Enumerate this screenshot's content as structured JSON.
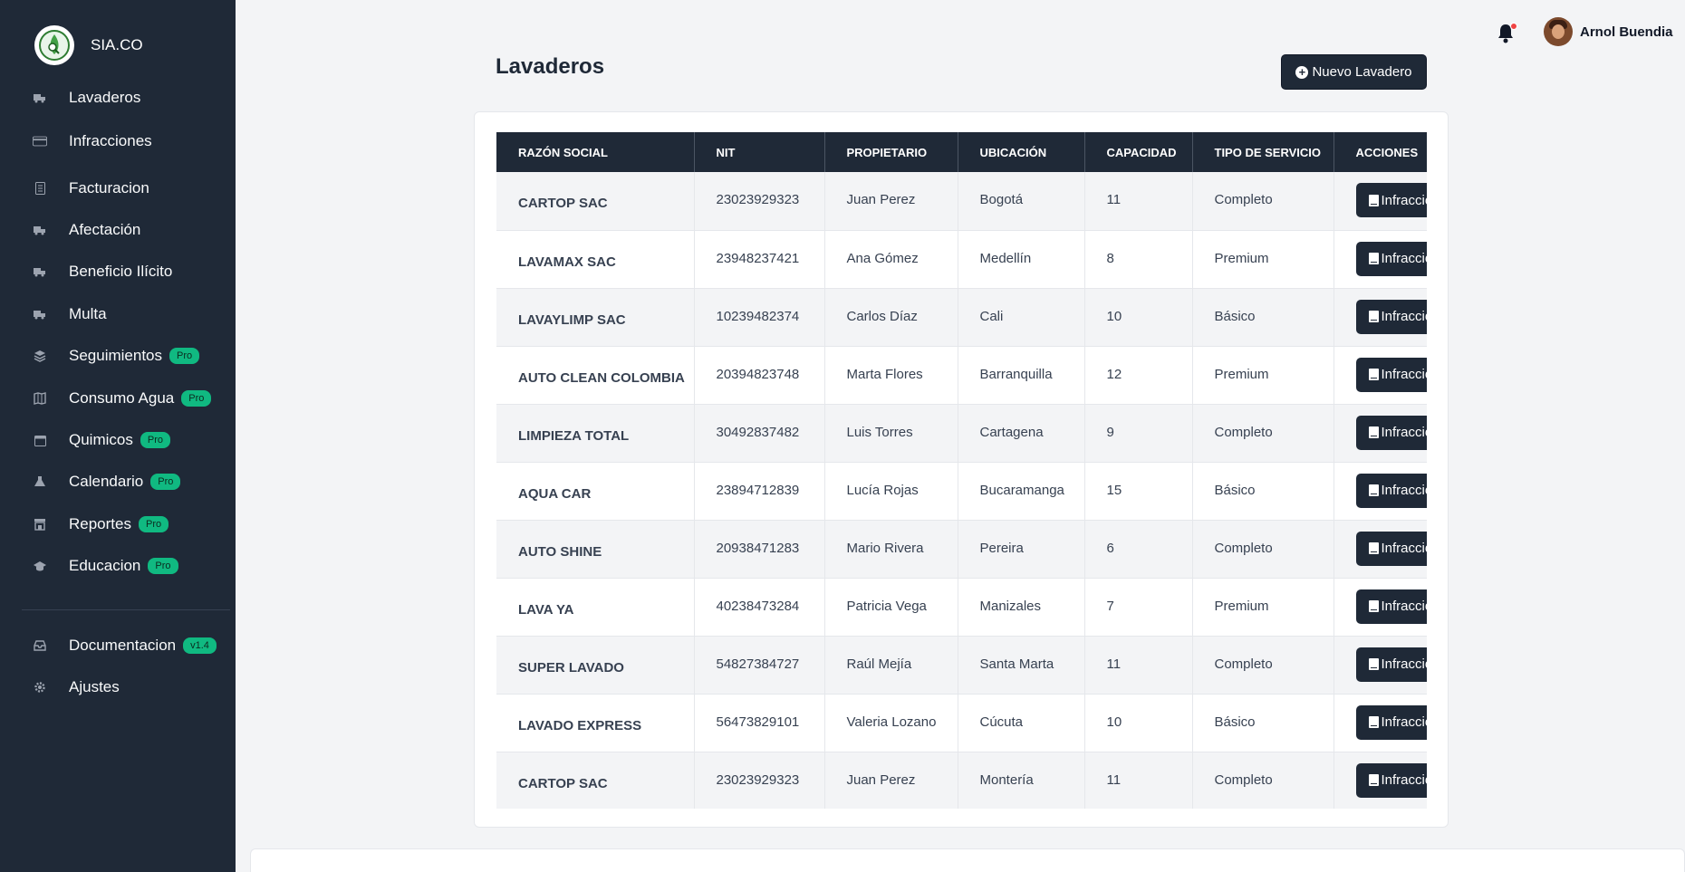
{
  "brand": {
    "name": "SIA.CO"
  },
  "sidebar": {
    "items": [
      {
        "label": "Lavaderos",
        "icon": "truck-icon",
        "badge": null
      },
      {
        "label": "Infracciones",
        "icon": "credit-card-icon",
        "badge": null
      },
      {
        "label": "Facturacion",
        "icon": "receipt-icon",
        "badge": null
      },
      {
        "label": "Afectación",
        "icon": "truck-icon",
        "badge": null
      },
      {
        "label": "Beneficio Ilícito",
        "icon": "truck-icon",
        "badge": null
      },
      {
        "label": "Multa",
        "icon": "truck-icon",
        "badge": null
      },
      {
        "label": "Seguimientos",
        "icon": "layers-icon",
        "badge": "Pro"
      },
      {
        "label": "Consumo Agua",
        "icon": "map-icon",
        "badge": "Pro"
      },
      {
        "label": "Quimicos",
        "icon": "calendar-icon",
        "badge": "Pro"
      },
      {
        "label": "Calendario",
        "icon": "flask-icon",
        "badge": "Pro"
      },
      {
        "label": "Reportes",
        "icon": "store-icon",
        "badge": "Pro"
      },
      {
        "label": "Educacion",
        "icon": "graduation-cap-icon",
        "badge": "Pro"
      }
    ],
    "secondary": [
      {
        "label": "Documentacion",
        "icon": "inbox-icon",
        "badge": "v1.4"
      },
      {
        "label": "Ajustes",
        "icon": "gear-icon",
        "badge": null
      }
    ]
  },
  "topbar": {
    "user_name": "Arnol Buendia"
  },
  "header": {
    "title": "Lavaderos",
    "new_button": "Nuevo Lavadero"
  },
  "table": {
    "columns": [
      "Razón Social",
      "NIT",
      "Propietario",
      "Ubicación",
      "Capacidad",
      "Tipo de Servicio",
      "Acciones"
    ],
    "action_label": "Infracciones",
    "rows": [
      [
        "CARTOP SAC",
        "23023929323",
        "Juan Perez",
        "Bogotá",
        "11",
        "Completo"
      ],
      [
        "LAVAMAX SAC",
        "23948237421",
        "Ana Gómez",
        "Medellín",
        "8",
        "Premium"
      ],
      [
        "LAVAYLIMP SAC",
        "10239482374",
        "Carlos Díaz",
        "Cali",
        "10",
        "Básico"
      ],
      [
        "AUTO CLEAN COLOMBIA",
        "20394823748",
        "Marta Flores",
        "Barranquilla",
        "12",
        "Premium"
      ],
      [
        "LIMPIEZA TOTAL",
        "30492837482",
        "Luis Torres",
        "Cartagena",
        "9",
        "Completo"
      ],
      [
        "AQUA CAR",
        "23894712839",
        "Lucía Rojas",
        "Bucaramanga",
        "15",
        "Básico"
      ],
      [
        "AUTO SHINE",
        "20938471283",
        "Mario Rivera",
        "Pereira",
        "6",
        "Completo"
      ],
      [
        "LAVA YA",
        "40238473284",
        "Patricia Vega",
        "Manizales",
        "7",
        "Premium"
      ],
      [
        "SUPER LAVADO",
        "54827384727",
        "Raúl Mejía",
        "Santa Marta",
        "11",
        "Completo"
      ],
      [
        "LAVADO EXPRESS",
        "56473829101",
        "Valeria Lozano",
        "Cúcuta",
        "10",
        "Básico"
      ],
      [
        "CARTOP SAC",
        "23023929323",
        "Juan Perez",
        "Montería",
        "11",
        "Completo"
      ]
    ]
  },
  "colors": {
    "sidebar_bg": "#1f2937",
    "accent_badge": "#10b981",
    "notification": "#ef4444"
  }
}
